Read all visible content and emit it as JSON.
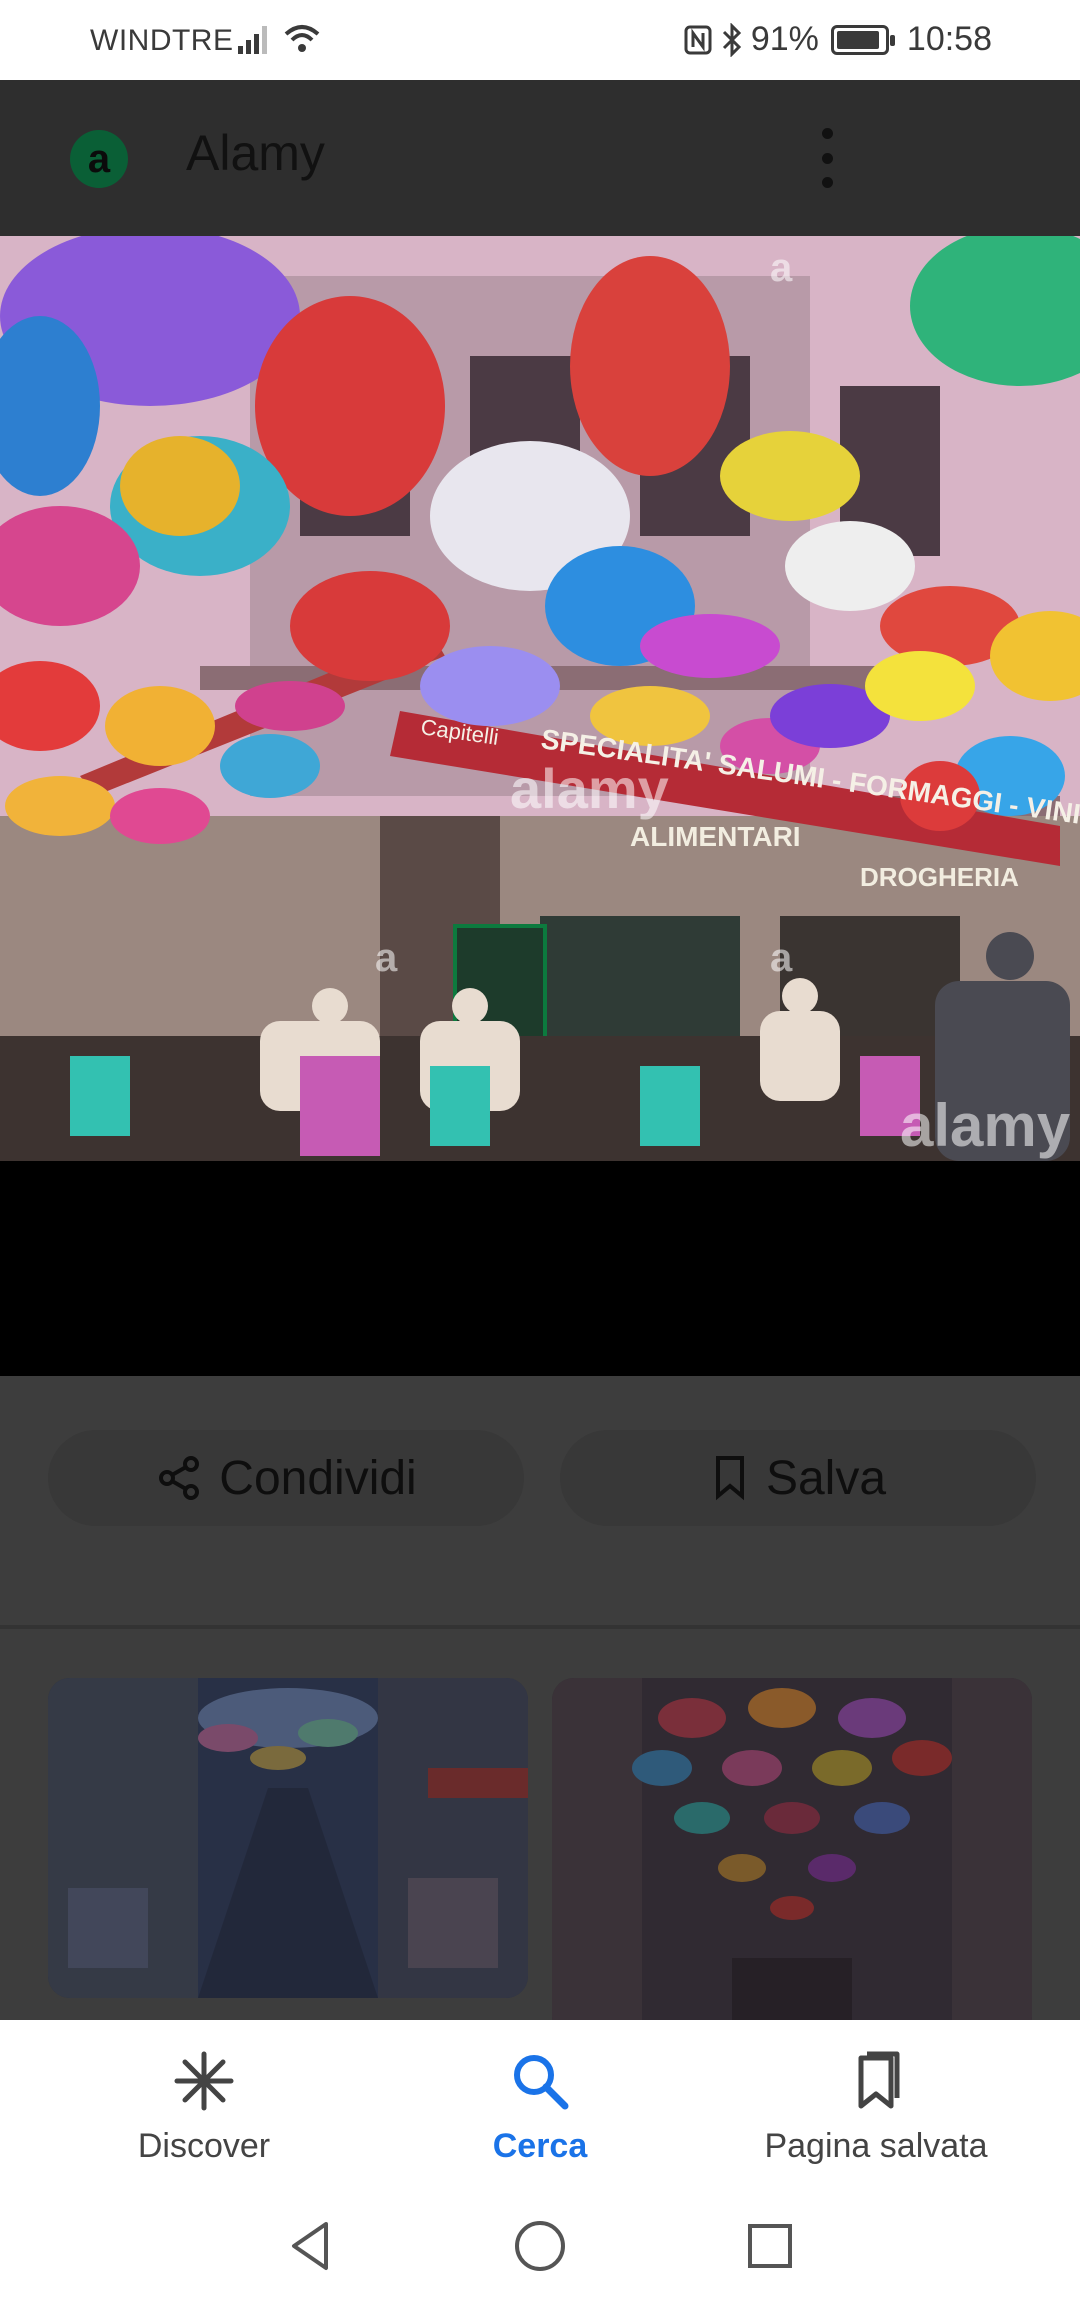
{
  "status_bar": {
    "carrier": "WINDTRE",
    "battery_level": 0.91,
    "battery_text": "91%",
    "time": "10:58",
    "icons": [
      "signal-icon",
      "wifi-icon",
      "nfc-icon",
      "bluetooth-icon",
      "battery-icon"
    ]
  },
  "header": {
    "logo_letter": "a",
    "site_name": "Alamy",
    "menu_icon": "more-vert-icon"
  },
  "photo": {
    "subject": "umbrellas-street-cafe",
    "watermarks": [
      "alamy",
      "alamy",
      "a",
      "a",
      "a"
    ],
    "awning_text": "SPECIALITA' SALUMI - FORMAGGI - VINI - LIQUORI - PANINI",
    "awning_brand": "Capitelli",
    "shop_sign_1": "ALIMENTARI",
    "shop_sign_2": "DROGHERIA"
  },
  "actions": {
    "share_label": "Condividi",
    "share_icon": "share-icon",
    "save_label": "Salva",
    "save_icon": "bookmark-icon"
  },
  "bottom_nav": {
    "items": [
      {
        "label": "Discover",
        "icon": "asterisk-icon",
        "active": false
      },
      {
        "label": "Cerca",
        "icon": "search-icon",
        "active": true
      },
      {
        "label": "Pagina salvata",
        "icon": "bookmarks-icon",
        "active": false
      }
    ]
  },
  "system_nav": [
    "back-icon",
    "home-icon",
    "recents-icon"
  ],
  "colors": {
    "active": "#1a73e8",
    "dim_overlay": "#3d3d3d"
  }
}
